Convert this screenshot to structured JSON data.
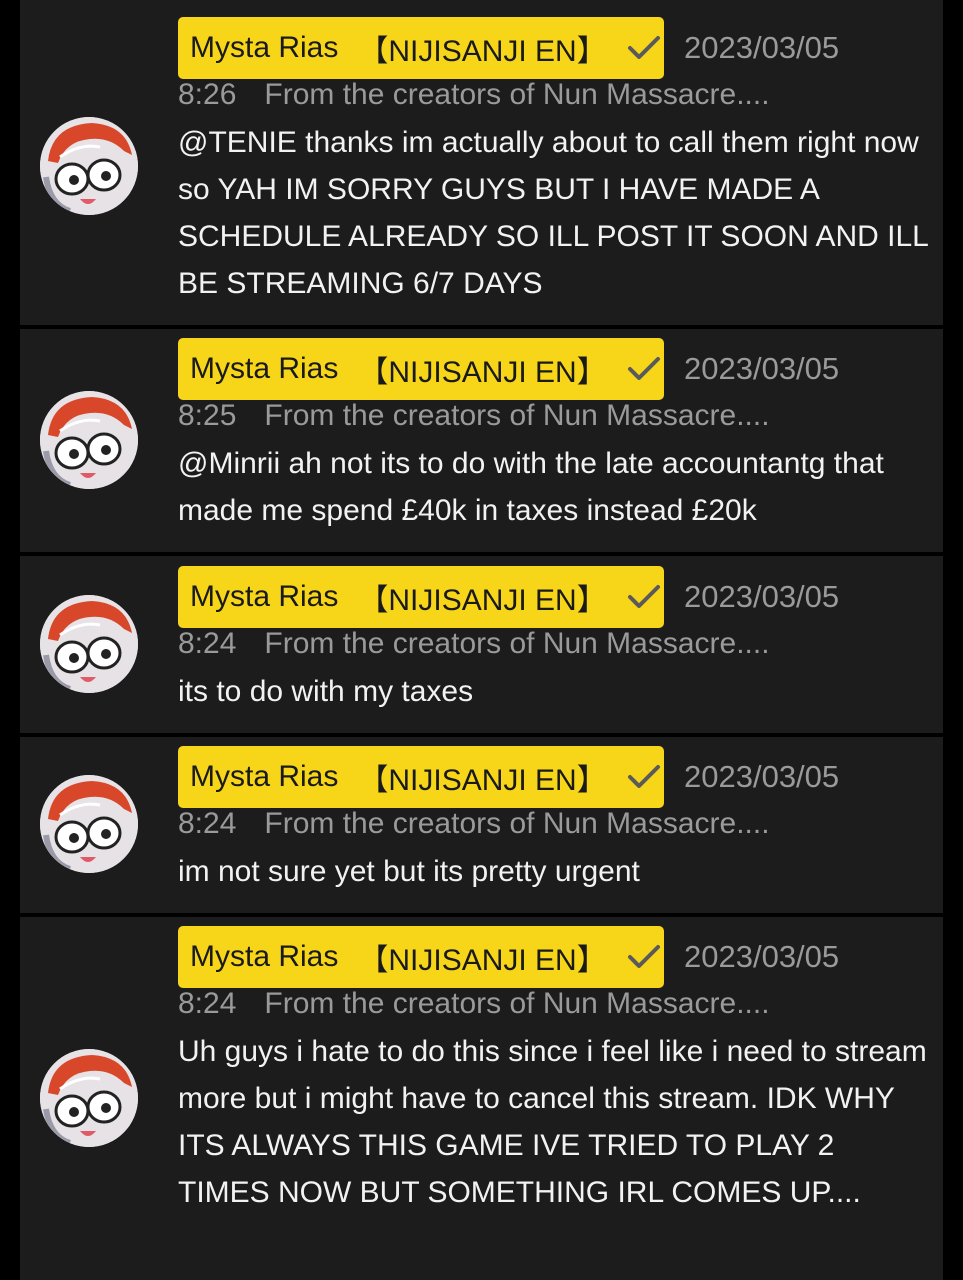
{
  "colors": {
    "background": "#000000",
    "card": "#1c1c1d",
    "name_highlight": "#f7d61a",
    "secondary_text": "#9a9a9a",
    "body_text": "#f2f2f2"
  },
  "posts": [
    {
      "author": "Mysta Rias",
      "tag": "【NIJISANJI EN】",
      "verified_icon": "check-icon",
      "date": "2023/03/05",
      "time": "8:26",
      "source": "From the creators of Nun Massacre....",
      "text": "@TENIE thanks im actually about to call them right now so YAH IM SORRY GUYS BUT I HAVE MADE A SCHEDULE ALREADY SO ILL POST IT SOON AND ILL BE STREAMING 6/7 DAYS"
    },
    {
      "author": "Mysta Rias",
      "tag": "【NIJISANJI EN】",
      "verified_icon": "check-icon",
      "date": "2023/03/05",
      "time": "8:25",
      "source": "From the creators of Nun Massacre....",
      "text": "@Minrii ah not its to do with the late accountantg that made me spend £40k in taxes instead £20k"
    },
    {
      "author": "Mysta Rias",
      "tag": "【NIJISANJI EN】",
      "verified_icon": "check-icon",
      "date": "2023/03/05",
      "time": "8:24",
      "source": "From the creators of Nun Massacre....",
      "text": "its to do with my taxes"
    },
    {
      "author": "Mysta Rias",
      "tag": "【NIJISANJI EN】",
      "verified_icon": "check-icon",
      "date": "2023/03/05",
      "time": "8:24",
      "source": "From the creators of Nun Massacre....",
      "text": "im not sure yet but its pretty urgent"
    },
    {
      "author": "Mysta Rias",
      "tag": "【NIJISANJI EN】",
      "verified_icon": "check-icon",
      "date": "2023/03/05",
      "time": "8:24",
      "source": "From the creators of Nun Massacre....",
      "text": "Uh guys i hate to do this since i feel like i need to stream more but i might have to cancel this stream. IDK WHY ITS ALWAYS THIS GAME IVE TRIED TO PLAY 2 TIMES NOW BUT SOMETHING IRL COMES UP...."
    }
  ]
}
